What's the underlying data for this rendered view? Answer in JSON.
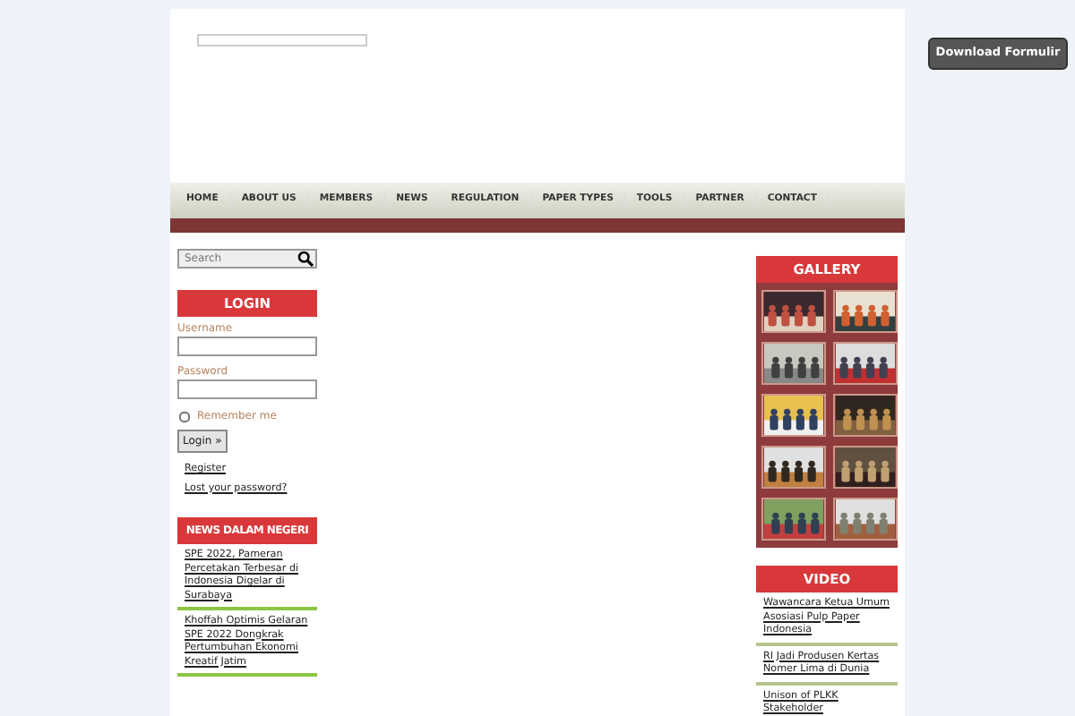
{
  "nav": [
    "HOME",
    "ABOUT US",
    "MEMBERS",
    "NEWS",
    "REGULATION",
    "PAPER TYPES",
    "TOOLS",
    "PARTNER",
    "CONTACT"
  ],
  "sidebar_left": {
    "search": {
      "placeholder": "Search"
    },
    "login": {
      "title": "LOGIN",
      "username_label": "Username",
      "password_label": "Password",
      "remember_label": "Remember me",
      "remember_checked": false,
      "button": "Login »",
      "links": [
        "Register",
        "Lost your password?"
      ]
    },
    "news": {
      "title": "NEWS DALAM NEGERI",
      "items": [
        "SPE 2022, Pameran Percetakan Terbesar di Indonesia Digelar di Surabaya",
        "Khoffah Optimis Gelaran SPE 2022 Dongkrak Pertumbuhan Ekonomi Kreatif Jatim"
      ]
    }
  },
  "sidebar_right": {
    "gallery": {
      "title": "GALLERY"
    },
    "video": {
      "title": "VIDEO",
      "items": [
        "Wawancara Ketua Umum Asosiasi Pulp Paper Indonesia",
        "RI Jadi Produsen Kertas Nomer Lima di Dunia",
        "Unison of PLKK Stakeholder"
      ]
    }
  },
  "download_button": "Download Formulir"
}
